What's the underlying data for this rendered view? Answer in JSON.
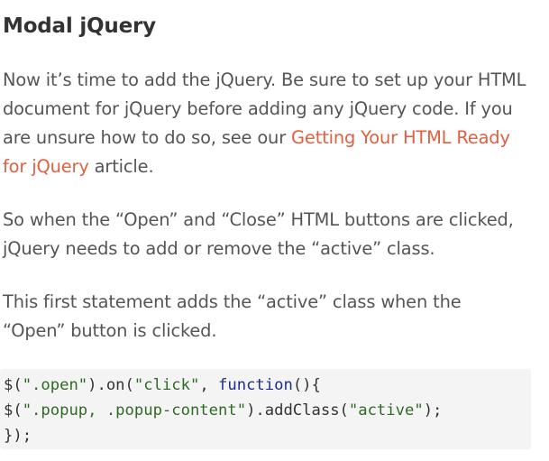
{
  "article": {
    "heading": "Modal jQuery",
    "p1": {
      "text_before": "Now it’s time to add the jQuery. Be sure to set up your HTML document for jQuery before adding any jQuery code. If you are unsure how to do so, see our ",
      "link_text": "Getting Your HTML Ready for jQuery",
      "text_after": " article."
    },
    "p2": "So when the “Open” and “Close” HTML buttons are clicked, jQuery needs to add or remove the “active” class.",
    "p3": "This first statement adds the “active” class when the “Open” button is clicked.",
    "code": {
      "line1": {
        "t1": "$(",
        "t2": "\".open\"",
        "t3": ").on(",
        "t4": "\"click\"",
        "t5": ", ",
        "t6": "function",
        "t7": "(){"
      },
      "line2": {
        "t1": "$(",
        "t2": "\".popup, .popup-content\"",
        "t3": ").addClass(",
        "t4": "\"active\"",
        "t5": ");"
      },
      "line3": {
        "t1": "});"
      }
    }
  },
  "colors": {
    "link": "#e0603f",
    "code_background": "#f4f4f4",
    "string": "#2f6b25",
    "keyword": "#1f2d8a"
  }
}
